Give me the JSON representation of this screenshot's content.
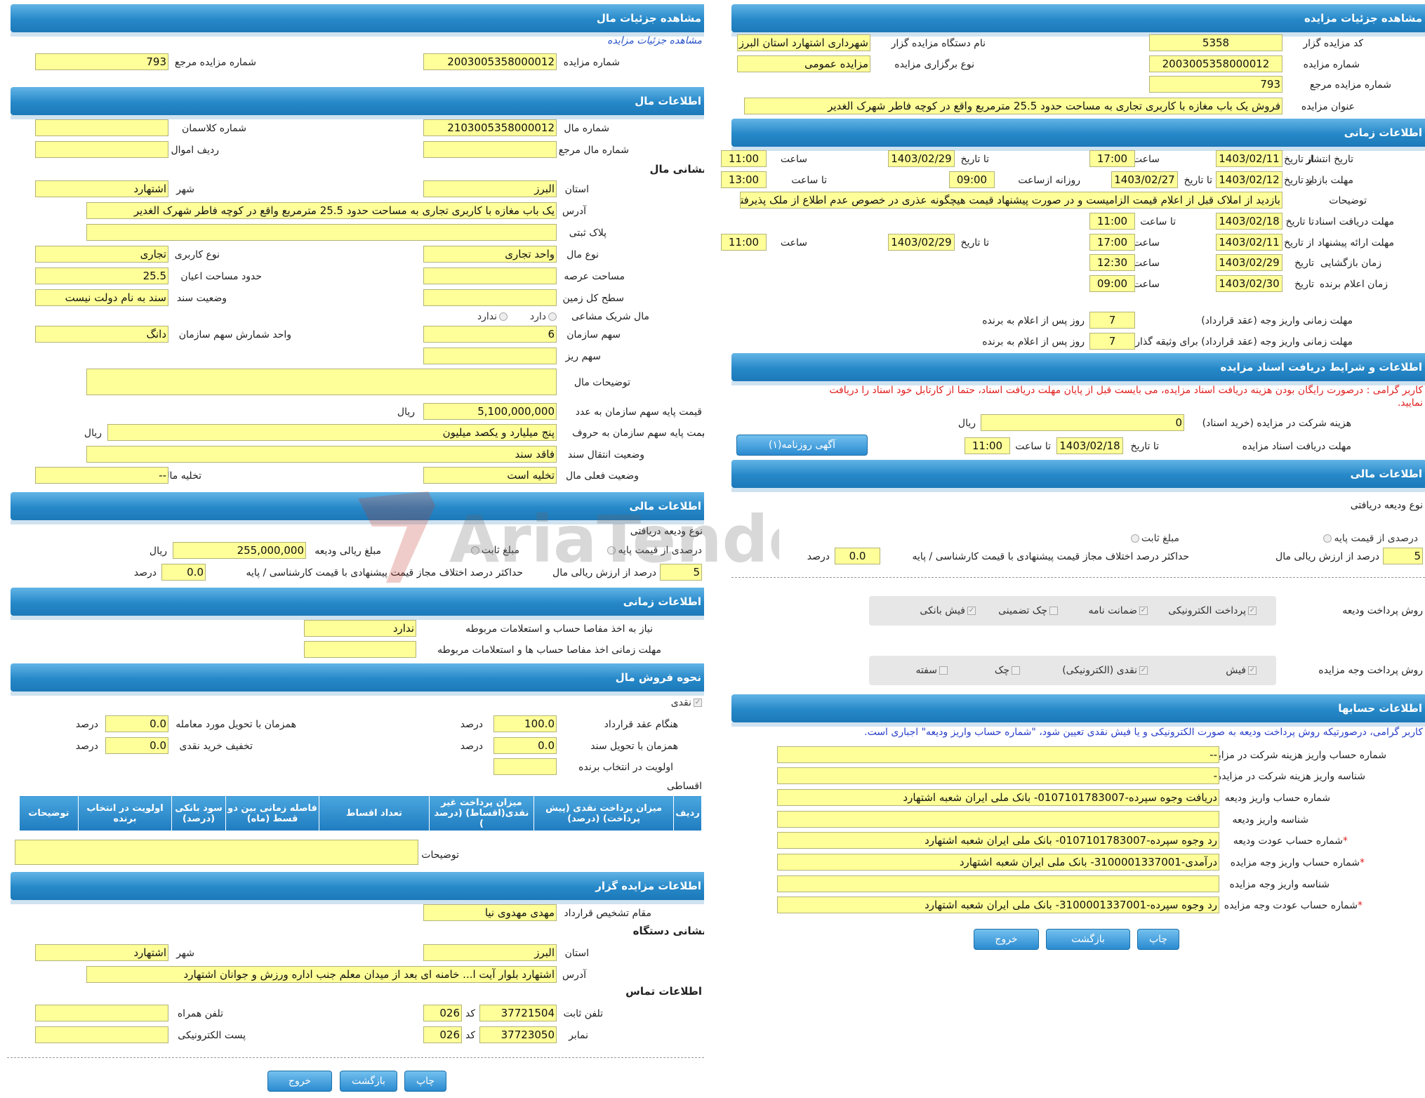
{
  "left": {
    "h_details": "مشاهده جزئیات مال",
    "link_details": "مشاهده جزئیات مزایده",
    "auction_no_label": "شماره مزایده",
    "auction_no": "2003005358000012",
    "ref_no_label": "شماره مزایده مرجع",
    "ref_no": "793",
    "h_property": "اطلاعات مال",
    "prop_no_label": "شماره مال",
    "prop_no": "2103005358000012",
    "classes_label": "شماره کلاسمان",
    "classes": "",
    "ref_prop_label": "شماره مال مرجع",
    "ref_prop": "",
    "row_label": "ردیف اموال",
    "row_val": "",
    "addr_title": "نشانی مال",
    "province_label": "استان",
    "province": "البرز",
    "city_label": "شهر",
    "city": "اشتهارد",
    "address_label": "آدرس",
    "address": "یک باب مغازه با کاربری تجاری به مساحت حدود 25.5 مترمربع واقع در کوچه فاطر شهرک الغدیر",
    "plate_label": "پلاک ثبتی",
    "plate": "",
    "type_label": "نوع مال",
    "type": "واحد تجاری",
    "usage_label": "نوع کاربری",
    "usage": "تجاری",
    "area_label": "مساحت عرصه",
    "area": "",
    "building_label": "حدود مساحت اعیان",
    "building": "25.5",
    "floor_label": "سطح کل زمین",
    "floor": "",
    "deed_label": "وضعیت سند",
    "deed": "سند به نام دولت نیست",
    "shared_label": "مال شریک مشاعی",
    "shared_yes": "دارد",
    "shared_no": "ندارد",
    "org_share_label": "سهم سازمان",
    "org_share": "6",
    "share_unit_label": "واحد شمارش سهم سازمان",
    "share_unit": "دانگ",
    "small_share_label": "سهم ریز",
    "small_share": "",
    "desc_label": "توضیحات مال",
    "desc": "",
    "base_price_label": "قیمت پایه سهم سازمان به عدد",
    "base_price": "5,100,000,000",
    "rial": "ریال",
    "base_words_label": "قیمت پایه سهم سازمان به حروف",
    "base_words": "پنج میلیارد و یکصد میلیون",
    "transfer_label": "وضعیت انتقال سند",
    "transfer": "فاقد سند",
    "current_label": "وضعیت فعلی مال",
    "current": "تخلیه است",
    "evac_label": "تخلیه مال",
    "evac": "--",
    "h_finance": "اطلاعات مالی",
    "deposit_type_label": "نوع ودیعه دریافتی",
    "percent_base": "درصدی از قیمت پایه",
    "fixed_amount": "مبلغ ثابت",
    "deposit_rial_label": "مبلغ ریالی ودیعه",
    "deposit_rial": "255,000,000",
    "deposit_pct": "5",
    "deposit_pct_label": "درصد از ارزش ریالی مال",
    "max_diff_label": "حداکثر درصد اختلاف مجاز قیمت پیشنهادی با قیمت کارشناسی / پایه",
    "max_diff": "0.0",
    "percent": "درصد",
    "h_time": "اطلاعات زمانی",
    "need_settle_label": "نیاز به اخذ مفاصا حساب و استعلامات مربوطه",
    "need_settle": "ندارد",
    "settle_deadline_label": "مهلت زمانی اخذ مفاصا حساب ها و استعلامات مربوطه",
    "settle_deadline": "",
    "h_sale": "نحوه فروش مال",
    "cash": "نقدی",
    "at_contract_label": "هنگام عقد قرارداد",
    "at_contract": "100.0",
    "with_delivery_label": "همزمان با تحویل مورد معامله",
    "with_delivery": "0.0",
    "with_doc_label": "همزمان با تحویل سند",
    "with_doc": "0.0",
    "cash_discount_label": "تخفیف خرید نقدی",
    "cash_discount": "0.0",
    "priority_label": "اولویت در انتخاب برنده",
    "priority": "",
    "installments": "اقساطی",
    "table_headers": [
      "ردیف",
      "میزان پرداخت نقدی (پیش پرداخت) (درصد)",
      "میزان پرداخت غیر نقدی(اقساط) (درصد )",
      "تعداد اقساط",
      "فاصله زمانی بین دو قسط (ماه)",
      "سود بانکی (درصد)",
      "اولویت در انتخاب برنده",
      "توضیحات"
    ],
    "notes_label": "توضیحات",
    "notes": "",
    "h_organizer": "اطلاعات مزایده گزار",
    "authority_label": "مقام تشخیص قرارداد",
    "authority": "مهدی مهدوی نیا",
    "org_addr_title": "نشانی دستگاه",
    "org_province": "البرز",
    "org_city": "اشتهارد",
    "org_address": "اشتهارد بلوار آیت ا... خامنه ای بعد از میدان معلم جنب اداره ورزش و جوانان اشتهارد",
    "contact_title": "اطلاعات تماس",
    "phone_label": "تلفن ثابت",
    "phone": "37721504",
    "code_label": "کد",
    "code": "026",
    "mobile_label": "تلفن همراه",
    "mobile": "",
    "fax_label": "نمابر",
    "fax": "37723050",
    "email_label": "پست الکترونیکی",
    "email": "",
    "btn_print": "چاپ",
    "btn_back": "بازگشت",
    "btn_exit": "خروج"
  },
  "right": {
    "h_details": "مشاهده جزئیات مزایده",
    "org_code_label": "کد مزایده گزار",
    "org_code": "5358",
    "org_name_label": "نام دستگاه مزایده گزار",
    "org_name": "شهرداری اشتهارد استان البرز",
    "auction_no_label": "شماره مزایده",
    "auction_no": "2003005358000012",
    "hold_type_label": "نوع برگزاری مزایده",
    "hold_type": "مزایده عمومی",
    "ref_no_label": "شماره مزایده مرجع",
    "ref_no": "793",
    "title_label": "عنوان مزایده",
    "title": "فروش یک باب مغازه با کاربری تجاری به مساحت حدود 25.5 مترمربع واقع در کوچه فاطر شهرک الغدیر",
    "h_time": "اطلاعات زمانی",
    "publish_label": "تاریخ انتشار",
    "from_date": "از تاریخ",
    "to_date": "تا تاریخ",
    "time": "ساعت",
    "to_time": "تا ساعت",
    "daily_from": "روزانه ازساعت",
    "publish_from": "1403/02/11",
    "publish_from_time": "17:00",
    "publish_to": "1403/02/29",
    "publish_to_time": "11:00",
    "visit_label": "مهلت بازدید",
    "visit_from": "1403/02/12",
    "visit_to": "1403/02/27",
    "visit_daily_from": "09:00",
    "visit_daily_to": "13:00",
    "notes_label": "توضیحات",
    "notes": "بازدید از املاک قبل از اعلام قیمت الزامیست و در صورت پیشنهاد قیمت هیچگونه عذری در خصوص عدم اطلاع از ملک پذیرفته نیست",
    "doc_recv_label": "مهلت دریافت اسناد",
    "doc_recv_to": "1403/02/18",
    "doc_recv_time": "11:00",
    "bid_label": "مهلت ارائه پیشنهاد",
    "bid_from": "1403/02/11",
    "bid_from_time": "17:00",
    "bid_to": "1403/02/29",
    "bid_to_time": "11:00",
    "open_label": "زمان بازگشایی",
    "date": "تاریخ",
    "open_date": "1403/02/29",
    "open_time": "12:30",
    "winner_label": "زمان اعلام برنده",
    "winner_date": "1403/02/30",
    "winner_time": "09:00",
    "pay_deadline_label": "مهلت زمانی واریز وجه (عقد قرارداد)",
    "pay_deadline": "7",
    "days_after": "روز پس از اعلام به برنده",
    "bail_deadline_label": "مهلت زمانی واریز وجه (عقد قرارداد) برای وثیقه گذار",
    "bail_deadline": "7",
    "h_docs": "اطلاعات و شرایط دریافت اسناد مزایده",
    "free_notice_1": "کاربر گرامی : درصورت رایگان بودن هزینه دریافت اسناد مزایده، می بایست قبل از پایان مهلت دریافت اسناد، حتما از کارتابل خود اسناد را دریافت",
    "free_notice_2": "نمایید.",
    "fee_label": "هزینه شرکت در مزایده (خرید اسناد)",
    "fee": "0",
    "rial": "ریال",
    "doc_deadline_label": "مهلت دریافت اسناد مزایده",
    "doc_deadline_date": "1403/02/18",
    "doc_deadline_time": "11:00",
    "newspaper_btn": "آگهی روزنامه(۱)",
    "h_finance": "اطلاعات مالی",
    "deposit_type_label": "نوع ودیعه دریافتی",
    "percent_base": "درصدی از قیمت پایه",
    "fixed_amount": "مبلغ ثابت",
    "deposit_pct": "5",
    "deposit_pct_label": "درصد از ارزش ریالی مال",
    "max_diff_label": "حداکثر درصد اختلاف مجاز قیمت پیشنهادی با قیمت کارشناسی / پایه",
    "max_diff": "0.0",
    "percent": "درصد",
    "deposit_method_label": "روش پرداخت ودیعه",
    "dm_electronic": "پرداخت الکترونیکی",
    "dm_guarantee": "ضمانت نامه",
    "dm_check": "چک تضمینی",
    "dm_receipt": "فیش بانکی",
    "pay_method_label": "روش پرداخت وجه مزایده",
    "pm_receipt": "فیش",
    "pm_cash": "نقدی (الکترونیکی)",
    "pm_check": "چک",
    "pm_promissory": "سفته",
    "h_accounts": "اطلاعات حسابها",
    "acc_notice": "کاربر گرامی، درصورتیکه روش پرداخت ودیعه به صورت الکترونیکی و یا فیش نقدی تعیین شود، \"شماره حساب واریز ودیعه\" اجباری است.",
    "acc_fee_label": "شماره حساب واریز هزینه شرکت در مزایده",
    "acc_fee": "--",
    "acc_fee_id_label": "شناسه واریز هزینه شرکت در مزایده",
    "acc_fee_id": "-",
    "acc_deposit_label": "شماره حساب واریز ودیعه",
    "acc_deposit": "دریافت وجوه سپرده-0107101783007- بانک ملی ایران شعبه اشتهارد",
    "acc_deposit_id_label": "شناسه واریز ودیعه",
    "acc_deposit_id": "",
    "acc_refund_label": "شماره حساب عودت ودیعه",
    "acc_refund": "رد وجوه سپرده-0107101783007- بانک ملی ایران شعبه اشتهارد",
    "acc_payment_label": "شماره حساب واریز وجه مزایده",
    "acc_payment": "درآمدی-3100001337001- بانک ملی ایران شعبه اشتهارد",
    "acc_payment_id_label": "شناسه واریز وجه مزایده",
    "acc_payment_id": "",
    "acc_pay_refund_label": "شماره حساب عودت وجه مزایده",
    "acc_pay_refund": "رد وجوه سپرده-3100001337001- بانک ملی ایران شعبه اشتهارد",
    "btn_print": "چاپ",
    "btn_back": "بازگشت",
    "btn_exit": "خروج"
  },
  "watermark": "AriaTender.neT"
}
